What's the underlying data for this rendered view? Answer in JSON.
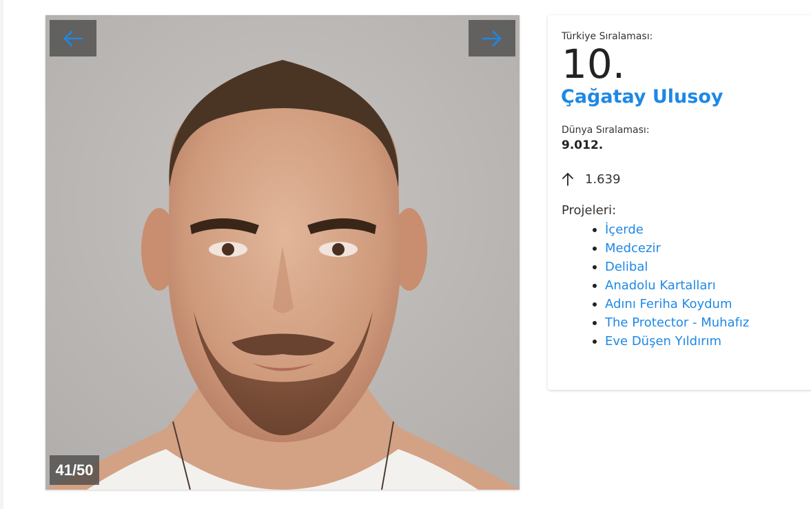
{
  "gallery": {
    "counter": "41/50",
    "prev_icon": "arrow-left-icon",
    "next_icon": "arrow-right-icon",
    "photo": "portrait-photo"
  },
  "info": {
    "turkey_rank_label": "Türkiye Sıralaması:",
    "turkey_rank_value": "10.",
    "name": "Çağatay Ulusoy",
    "world_rank_label": "Dünya Sıralaması:",
    "world_rank_value": "9.012.",
    "change_icon": "arrow-up-icon",
    "change_value": "1.639",
    "projects_label": "Projeleri:",
    "projects": [
      "İçerde",
      "Medcezir",
      "Delibal",
      "Anadolu Kartalları",
      "Adını Feriha Koydum",
      "The Protector - Muhafız",
      "Eve Düşen Yıldırım"
    ]
  },
  "colors": {
    "accent": "#1e88e5",
    "nav_bg": "#464646",
    "photo_bg": "#bcb9b6"
  }
}
